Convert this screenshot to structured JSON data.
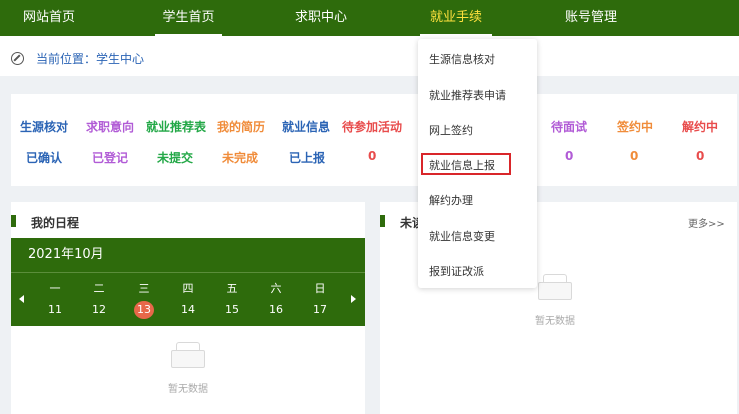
{
  "nav": {
    "items": [
      {
        "label": "网站首页"
      },
      {
        "label": "学生首页"
      },
      {
        "label": "求职中心"
      },
      {
        "label": "就业手续"
      },
      {
        "label": "账号管理"
      }
    ]
  },
  "breadcrumb": {
    "label": "当前位置：学生中心"
  },
  "stats": {
    "items": [
      {
        "label": "生源核对",
        "value": "已确认",
        "color": "#2b64b5"
      },
      {
        "label": "求职意向",
        "value": "已登记",
        "color": "#b15bd6"
      },
      {
        "label": "就业推荐表",
        "value": "未提交",
        "color": "#23a847"
      },
      {
        "label": "我的简历",
        "value": "未完成",
        "color": "#f08c3a"
      },
      {
        "label": "就业信息",
        "value": "已上报",
        "color": "#2b64b5"
      },
      {
        "label": "待参加活动",
        "value": "0",
        "color": "#e84c4c"
      },
      {
        "label": "待面试",
        "value": "0",
        "color": "#b15bd6"
      },
      {
        "label": "签约中",
        "value": "0",
        "color": "#f08c3a"
      },
      {
        "label": "解约中",
        "value": "0",
        "color": "#e84c4c"
      }
    ]
  },
  "schedule": {
    "title": "我的日程",
    "month": "2021年10月",
    "weekdays": [
      "一",
      "二",
      "三",
      "四",
      "五",
      "六",
      "日"
    ],
    "days": [
      "11",
      "12",
      "13",
      "14",
      "15",
      "16",
      "17"
    ],
    "today_index": 2,
    "empty_text": "暂无数据"
  },
  "unread": {
    "title": "未读",
    "more_label": "更多>>",
    "empty_text": "暂无数据"
  },
  "dropdown": {
    "items": [
      {
        "label": "生源信息核对"
      },
      {
        "label": "就业推荐表申请"
      },
      {
        "label": "网上签约"
      },
      {
        "label": "就业信息上报"
      },
      {
        "label": "解约办理"
      },
      {
        "label": "就业信息变更"
      },
      {
        "label": "报到证改派"
      }
    ],
    "highlight_color": "#d9262a"
  },
  "colors": {
    "nav_bg": "#2e6b0c",
    "nav_active": "#ffe13d",
    "today_bg": "#e8684a"
  }
}
